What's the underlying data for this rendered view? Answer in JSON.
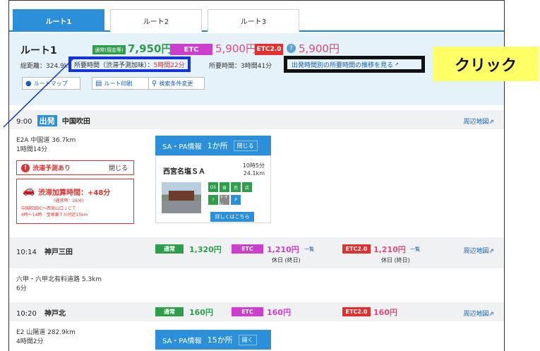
{
  "tabs": [
    {
      "label": "ルート1"
    },
    {
      "label": "ルート2"
    },
    {
      "label": "ルート3"
    }
  ],
  "summary": {
    "title": "ルート1",
    "normal_badge": "通常(現金等)",
    "normal_price": "7,950円",
    "etc_badge": "ETC",
    "etc_price": "5,900円",
    "etc2_badge": "ETC2.0",
    "etc2_price": "5,900円",
    "distance": "総距離：324.9km",
    "time_label": "所要時間（渋滞予測加味）：",
    "time_value": "5時間22分",
    "time_normal": "所要時間：3時間41分",
    "trend_link": "出発時間別の所要時間の推移を見る",
    "btn_map": "ルートマップ",
    "btn_print": "ルート印刷",
    "btn_cond": "検索条件変更"
  },
  "callout": {
    "label": "クリック"
  },
  "stops": [
    {
      "time": "9:00",
      "badge": "出発",
      "name": "中国吹田",
      "near": "周辺地図"
    },
    {
      "time": "10:14",
      "name": "神戸三田",
      "near": "周辺地図"
    },
    {
      "time": "10:20",
      "name": "神戸北",
      "near": "周辺地図"
    }
  ],
  "segments": [
    {
      "road": "E2A 中国道 36.7km",
      "duration": "1時間14分"
    },
    {
      "road": "六甲・六甲北有料道路 5.3km",
      "duration": "6分"
    },
    {
      "road": "E2 山陽道 282.9km",
      "duration": "4時間2分"
    }
  ],
  "jam": {
    "label": "渋滞予測あり",
    "close": "閉じる",
    "add_time": "渋滞加算時間：+48分",
    "normal": "(通常時：26分)",
    "range": "中国吹田IC～西宮山口ＪＣＴ",
    "time": "6時～14時　宝塚東ＴＮ付近15km"
  },
  "sa_panels": [
    {
      "title": "SA・PA情報",
      "count": "1か所",
      "toggle": "閉じる"
    },
    {
      "title": "SA・PA情報",
      "count": "15か所",
      "toggle": "開く"
    }
  ],
  "sa": {
    "name": "西宮名塩ＳＡ",
    "time": "10時5分",
    "dist": "24.1km",
    "facilities": [
      "GS",
      "食",
      "売",
      "店",
      "?",
      "トイレ",
      "P"
    ],
    "more": "詳しくはこちら"
  },
  "tolls": [
    {
      "normal_badge": "通常",
      "normal_price": "1,320円",
      "etc_badge": "ETC",
      "etc_price": "1,210円",
      "etc_list": "一覧",
      "etc_note": "休日 (終日)",
      "etc2_badge": "ETC2.0",
      "etc2_price": "1,210円",
      "etc2_list": "一覧",
      "etc2_note": "休日 (終日)"
    },
    {
      "normal_badge": "通常",
      "normal_price": "160円",
      "etc_badge": "ETC",
      "etc_price": "160円",
      "etc2_badge": "ETC2.0",
      "etc2_price": "160円"
    }
  ],
  "colors": {
    "accent": "#2b90d9",
    "green": "#2e9e4b",
    "etc": "#cc3fcc",
    "etc2": "#e03030",
    "highlight": "#ffff66"
  }
}
